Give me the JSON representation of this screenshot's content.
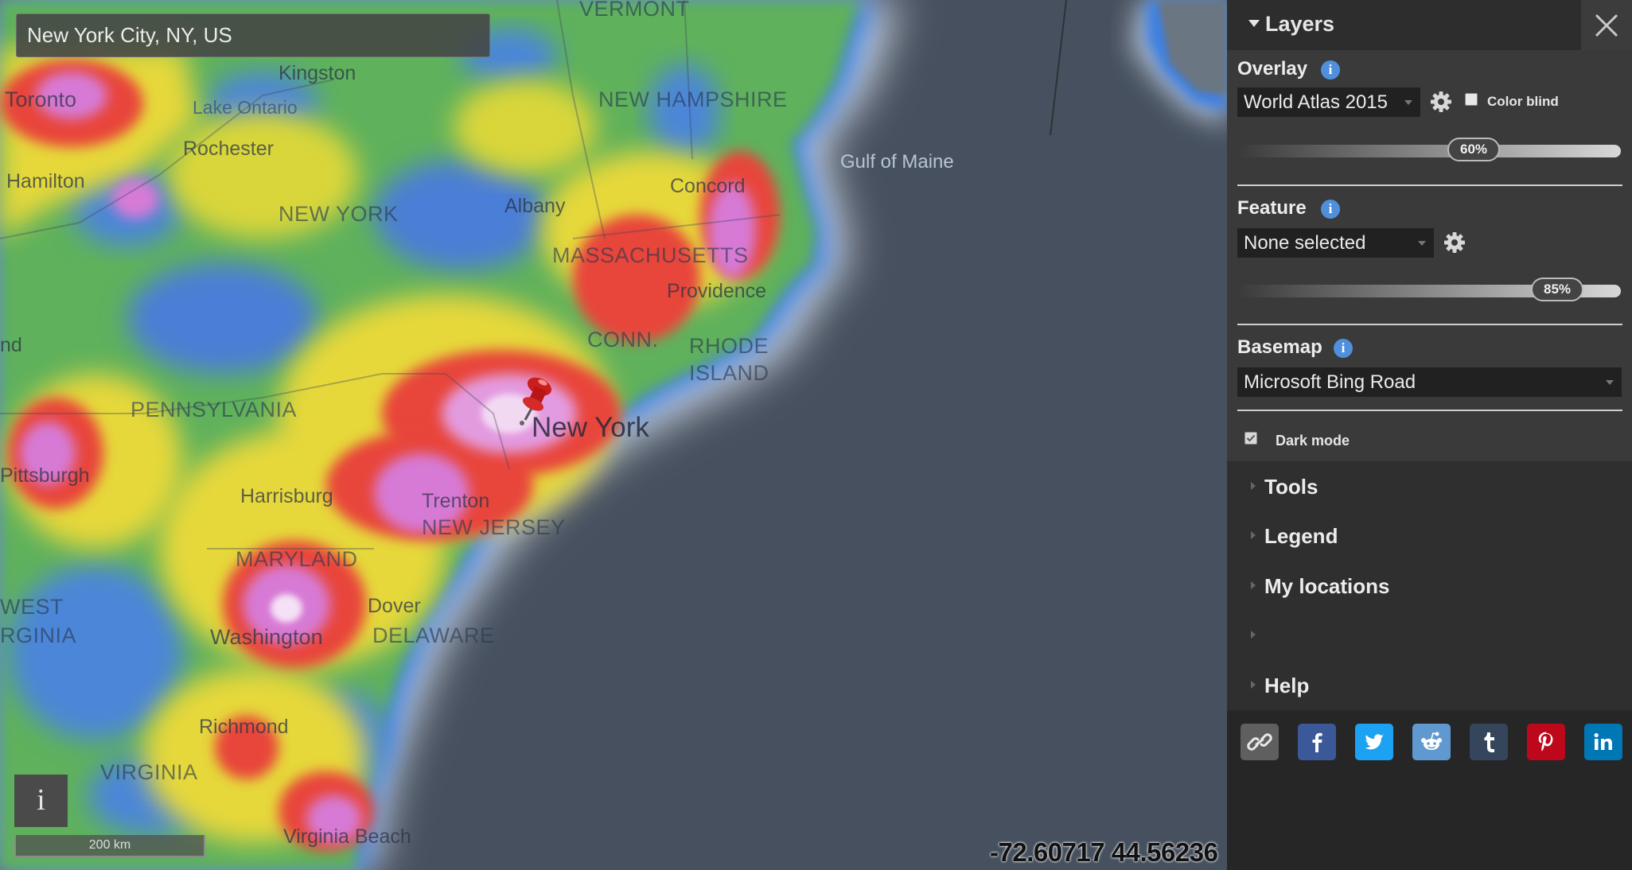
{
  "search": {
    "value": "New York City, NY, US"
  },
  "map": {
    "info_button": "i",
    "scale_label": "200 km",
    "coordinates": "-72.60717 44.56236",
    "labels": {
      "vermont": "VERMONT",
      "new_hampshire": "NEW HAMPSHIRE",
      "gulf_of_maine": "Gulf of Maine",
      "kingston": "Kingston",
      "toronto": "Toronto",
      "lake_ontario": "Lake Ontario",
      "rochester": "Rochester",
      "hamilton": "Hamilton",
      "new_york_state": "NEW YORK",
      "albany": "Albany",
      "concord": "Concord",
      "massachusetts": "MASSACHUSETTS",
      "providence": "Providence",
      "conn": "CONN.",
      "rhode": "RHODE",
      "island": "ISLAND",
      "nd": "nd",
      "pennsylvania": "PENNSYLVANIA",
      "new_york_city": "New York",
      "pittsburgh": "Pittsburgh",
      "harrisburg": "Harrisburg",
      "trenton": "Trenton",
      "new_jersey": "NEW JERSEY",
      "maryland": "MARYLAND",
      "west": "WEST",
      "irginia": "RGINIA",
      "dover": "Dover",
      "washington": "Washington",
      "delaware": "DELAWARE",
      "richmond": "Richmond",
      "virginia": "VIRGINIA",
      "virginia_beach": "Virginia Beach"
    }
  },
  "panel": {
    "title": "Layers",
    "overlay": {
      "title": "Overlay",
      "selected": "World Atlas 2015",
      "color_blind_label": "Color blind",
      "color_blind_checked": false,
      "opacity_label": "60%",
      "opacity": 0.6
    },
    "feature": {
      "title": "Feature",
      "selected": "None selected",
      "opacity_label": "85%",
      "opacity": 0.85
    },
    "basemap": {
      "title": "Basemap",
      "selected": "Microsoft Bing Road",
      "dark_mode_label": "Dark mode",
      "dark_mode_checked": true
    },
    "menu": [
      "Tools",
      "Legend",
      "My locations",
      "",
      "Help"
    ],
    "share_icons": [
      "link-icon",
      "facebook-icon",
      "twitter-icon",
      "reddit-icon",
      "tumblr-icon",
      "pinterest-icon",
      "linkedin-icon"
    ],
    "share_colors": {
      "link": "#5f5f5f",
      "facebook": "#3b5998",
      "twitter": "#1da1f2",
      "reddit": "#5f99cf",
      "tumblr": "#35465c",
      "pinterest": "#bd081c",
      "linkedin": "#0077b5"
    },
    "info_icon_color": "#4f8fdb"
  }
}
